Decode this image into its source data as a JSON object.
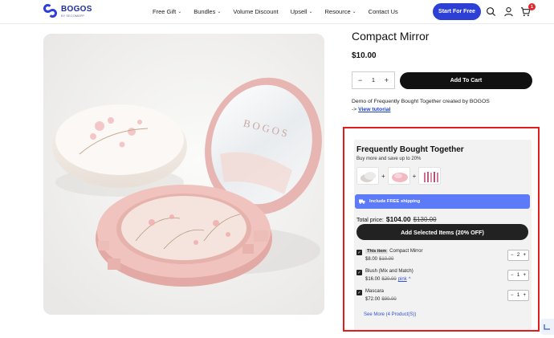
{
  "header": {
    "logo_name": "BOGOS",
    "logo_tag": "BY SECOMAPP",
    "nav": [
      {
        "label": "Free Gift",
        "dropdown": true
      },
      {
        "label": "Bundles",
        "dropdown": true
      },
      {
        "label": "Volume Discount",
        "dropdown": false
      },
      {
        "label": "Upsell",
        "dropdown": true
      },
      {
        "label": "Resource",
        "dropdown": true
      },
      {
        "label": "Contact Us",
        "dropdown": false
      }
    ],
    "cta_label": "Start For Free",
    "cart_count": "1",
    "brand_color": "#2e3fd6"
  },
  "product": {
    "title": "Compact Mirror",
    "price": "$10.00",
    "quantity": "1",
    "add_to_cart_label": "Add To Cart",
    "demo_text": "Demo of Frequently Bought Together created by BOGOS",
    "link_prefix": "->",
    "link_label": "View tutorial",
    "image_brand_text": "BOGOS"
  },
  "widget": {
    "title": "Frequently Bought Together",
    "subtitle": "Buy more and save up to 20%",
    "shipping_label": "Include FREE shipping",
    "total_label": "Total price:",
    "total_price": "$104.00",
    "total_old_price": "$130.00",
    "add_selected_label": "Add Selected Items (20% OFF)",
    "items": [
      {
        "tag": "This item",
        "name": "Compact Mirror",
        "price": "$8.00",
        "old_price": "$10.00",
        "variant": "",
        "qty": "2"
      },
      {
        "tag": "",
        "name": "Blush (Mix and Match)",
        "price": "$16.00",
        "old_price": "$20.00",
        "variant": "pink",
        "qty": "1"
      },
      {
        "tag": "",
        "name": "Mascara",
        "price": "$72.00",
        "old_price": "$90.00",
        "variant": "",
        "qty": "1"
      }
    ],
    "see_more_label": "See More (4 Product(S))",
    "accent_color": "#5d7af8"
  }
}
